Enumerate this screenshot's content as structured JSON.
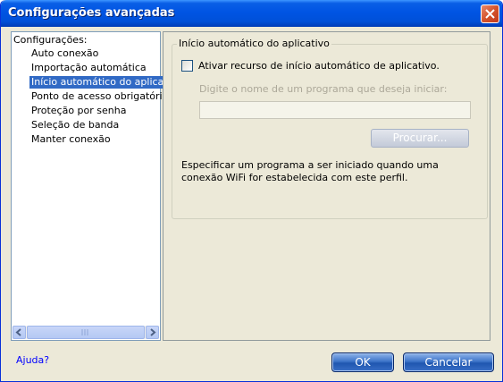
{
  "window": {
    "title": "Configurações avançadas"
  },
  "tree": {
    "root": "Configurações:",
    "items": [
      "Auto conexão",
      "Importação automática",
      "Início automático do aplicativo",
      "Ponto de acesso obrigatório",
      "Proteção por senha",
      "Seleção de banda",
      "Manter conexão"
    ],
    "selected": "Início automático do aplicativo"
  },
  "panel": {
    "group_title": "Início automático do aplicativo",
    "checkbox_label": "Ativar recurso de início automático de aplicativo.",
    "checkbox_checked": false,
    "input_hint": "Digite o nome de um programa que deseja iniciar:",
    "input_value": "",
    "browse_label": "Procurar...",
    "description": "Especificar um programa a ser iniciado quando uma conexão WiFi for estabelecida com este perfil."
  },
  "footer": {
    "help_label": "Ajuda?",
    "ok_label": "OK",
    "cancel_label": "Cancelar"
  },
  "colors": {
    "titlebar": "#0054e3",
    "selection": "#316ac5",
    "link": "#0000ff",
    "button_blue": "#3e74c9"
  },
  "icons": {
    "close": "close-icon",
    "scroll_left": "arrow-left-icon",
    "scroll_right": "arrow-right-icon"
  }
}
